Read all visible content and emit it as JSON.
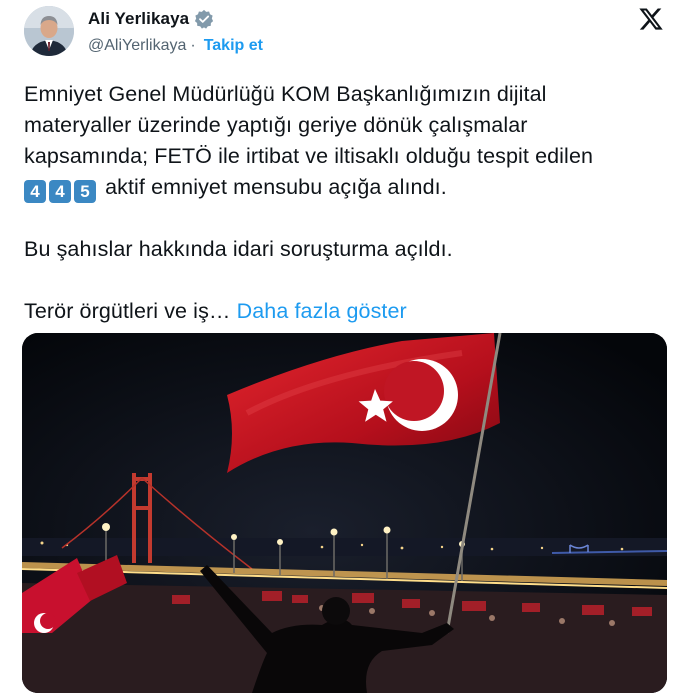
{
  "author": {
    "name": "Ali Yerlikaya",
    "handle": "@AliYerlikaya",
    "separator": "·",
    "follow_label": "Takip et"
  },
  "tweet": {
    "line1": "Emniyet Genel Müdürlüğü KOM Başkanlığımızın dijital",
    "line2": "materyaller üzerinde yaptığı geriye dönük çalışmalar",
    "line3": "kapsamında; FETÖ ile irtibat ve iltisaklı olduğu tespit edilen",
    "digits": [
      "4",
      "4",
      "5"
    ],
    "line4_rest": "aktif emniyet mensubu açığa alındı.",
    "paragraph2": "Bu şahıslar hakkında idari soruşturma açıldı.",
    "paragraph3": "Terör örgütleri ve iş…",
    "show_more": "Daha fazla göster"
  },
  "colors": {
    "link": "#1d9bf0",
    "verified": "#829aab",
    "keycap": "#3b88c3",
    "flag_red": "#c8102e"
  },
  "icons": [
    "verified-badge-icon",
    "x-logo-icon"
  ]
}
